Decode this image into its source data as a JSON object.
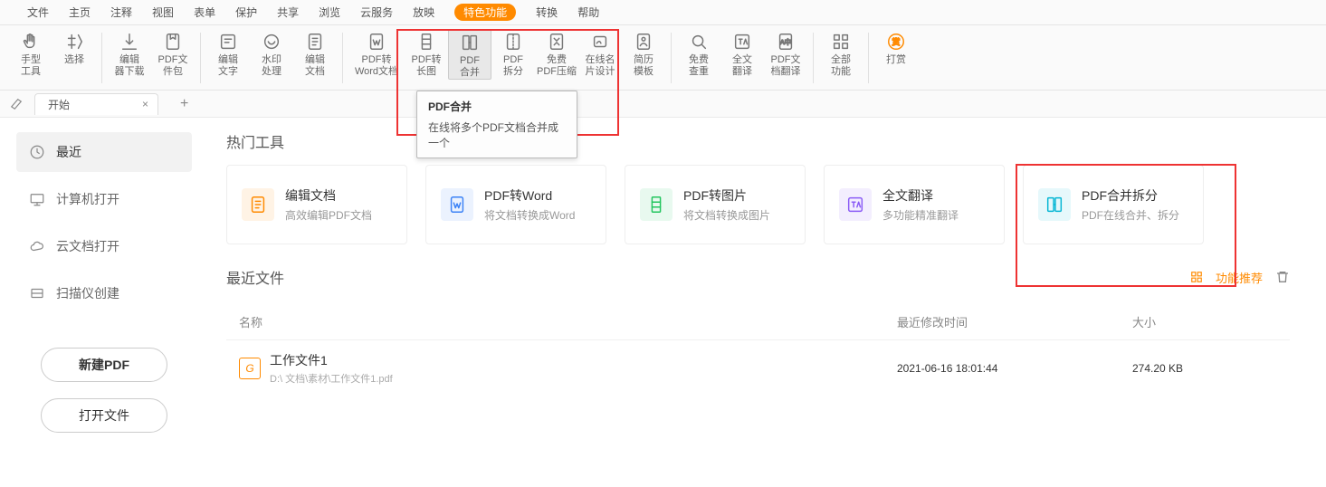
{
  "menubar": [
    "文件",
    "主页",
    "注释",
    "视图",
    "表单",
    "保护",
    "共享",
    "浏览",
    "云服务",
    "放映",
    "特色功能",
    "转换",
    "帮助"
  ],
  "menubar_pill_index": 10,
  "toolbar_groups": [
    [
      {
        "id": "hand-tool",
        "label": "手型\n工具",
        "icon": "hand"
      },
      {
        "id": "select-tool",
        "label": "选择",
        "icon": "select"
      }
    ],
    [
      {
        "id": "editor-download",
        "label": "编辑\n器下载",
        "icon": "download"
      },
      {
        "id": "pdf-pkg",
        "label": "PDF文\n件包",
        "icon": "filepkg"
      }
    ],
    [
      {
        "id": "edit-text",
        "label": "编辑\n文字",
        "icon": "edittext"
      },
      {
        "id": "watermark",
        "label": "水印\n处理",
        "icon": "watermark"
      },
      {
        "id": "edit-doc",
        "label": "编辑\n文档",
        "icon": "editdoc"
      }
    ],
    [
      {
        "id": "pdf2word",
        "label": "PDF转\nWord文档",
        "icon": "toword"
      },
      {
        "id": "pdf2longimg",
        "label": "PDF转\n长图",
        "icon": "tolongimg"
      },
      {
        "id": "pdf-merge",
        "label": "PDF\n合并",
        "icon": "merge",
        "active": true
      },
      {
        "id": "pdf-split",
        "label": "PDF\n拆分",
        "icon": "split"
      },
      {
        "id": "free-compress",
        "label": "免费\nPDF压缩",
        "icon": "compress"
      },
      {
        "id": "online-sign",
        "label": "在线名\n片设计",
        "icon": "sign"
      },
      {
        "id": "resume-tpl",
        "label": "简历\n模板",
        "icon": "resume"
      }
    ],
    [
      {
        "id": "free-dedup",
        "label": "免费\n查重",
        "icon": "dedup"
      },
      {
        "id": "fulltext-trans",
        "label": "全文\n翻译",
        "icon": "fulltrans"
      },
      {
        "id": "pdf-doc-trans",
        "label": "PDF文\n档翻译",
        "icon": "doctrans"
      }
    ],
    [
      {
        "id": "all-funcs",
        "label": "全部\n功能",
        "icon": "all"
      }
    ],
    [
      {
        "id": "reward",
        "label": "打赏",
        "icon": "reward"
      }
    ]
  ],
  "tab": {
    "label": "开始"
  },
  "sidebar": {
    "items": [
      {
        "id": "recent",
        "label": "最近",
        "icon": "clock",
        "active": true
      },
      {
        "id": "computer-open",
        "label": "计算机打开",
        "icon": "computer"
      },
      {
        "id": "cloud-open",
        "label": "云文档打开",
        "icon": "cloud"
      },
      {
        "id": "scanner-create",
        "label": "扫描仪创建",
        "icon": "scanner"
      }
    ],
    "new_btn": "新建PDF",
    "open_btn": "打开文件"
  },
  "main": {
    "hot_title": "热门工具",
    "cards": [
      {
        "id": "edit",
        "title": "编辑文档",
        "desc": "高效编辑PDF文档",
        "color": "#ff8a00"
      },
      {
        "id": "toword",
        "title": "PDF转Word",
        "desc": "将文档转换成Word",
        "color": "#3b82f6"
      },
      {
        "id": "toimg",
        "title": "PDF转图片",
        "desc": "将文档转换成图片",
        "color": "#22c55e"
      },
      {
        "id": "fulltrans",
        "title": "全文翻译",
        "desc": "多功能精准翻译",
        "color": "#8b5cf6"
      },
      {
        "id": "mergesplit",
        "title": "PDF合并拆分",
        "desc": "PDF在线合并、拆分",
        "color": "#06b6d4"
      }
    ],
    "recent_title": "最近文件",
    "func_rec": "功能推荐",
    "cols": {
      "name": "名称",
      "time": "最近修改时间",
      "size": "大小"
    },
    "files": [
      {
        "name": "工作文件1",
        "path": "D:\\        文档\\素材\\工作文件1.pdf",
        "time": "2021-06-16 18:01:44",
        "size": "274.20 KB"
      }
    ]
  },
  "tooltip": {
    "title": "PDF合并",
    "desc": "在线将多个PDF文档合并成一个"
  }
}
